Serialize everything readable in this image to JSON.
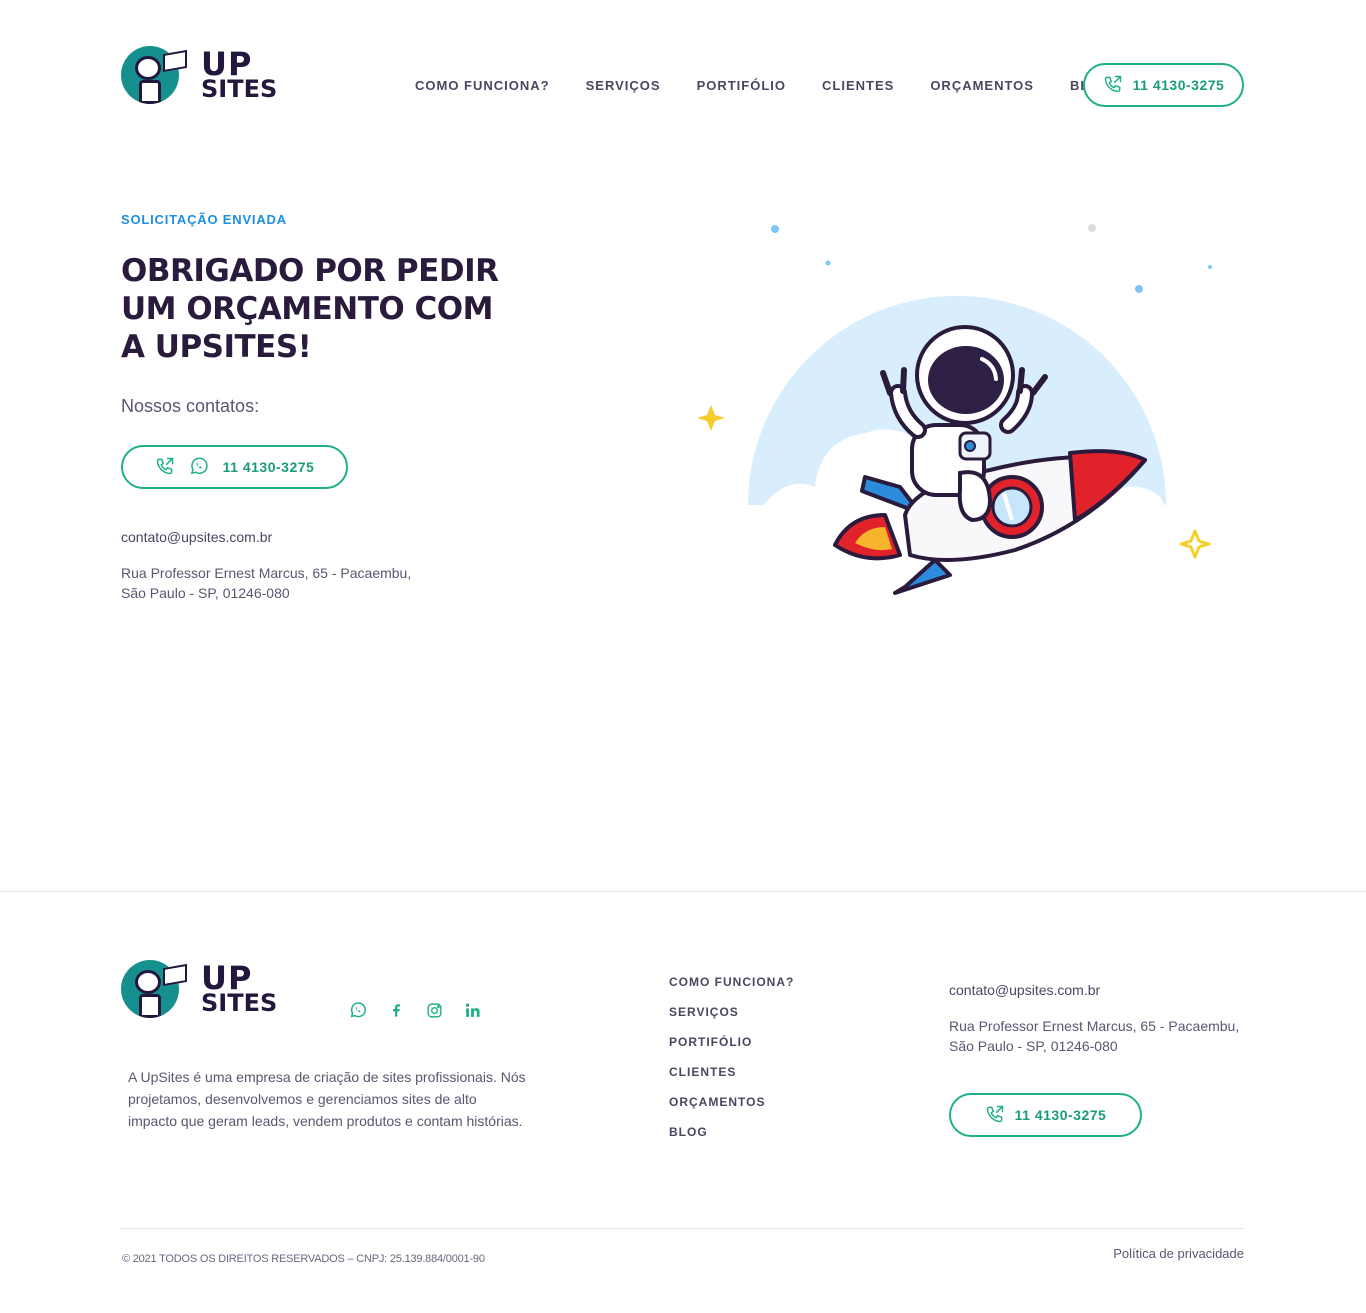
{
  "brand": {
    "name_top": "UP",
    "name_bottom": "SITES",
    "primary_color": "#15908f",
    "dark_color": "#24173d",
    "accent_green": "#1fb08a",
    "accent_blue": "#1e8fe0"
  },
  "header": {
    "nav": [
      {
        "label": "COMO FUNCIONA?"
      },
      {
        "label": "SERVIÇOS"
      },
      {
        "label": "PORTIFÓLIO"
      },
      {
        "label": "CLIENTES"
      },
      {
        "label": "ORÇAMENTOS"
      },
      {
        "label": "BLOG"
      }
    ],
    "phone_label": "11 4130-3275",
    "phone_icon": "phone-outgoing-icon"
  },
  "hero": {
    "eyebrow": "SOLICITAÇÃO ENVIADA",
    "headline": "OBRIGADO POR PEDIR UM ORÇAMENTO COM A UPSITES!",
    "subhead": "Nossos contatos:",
    "phone_label": "11 4130-3275",
    "phone_icons": [
      "phone-outgoing-icon",
      "whatsapp-icon"
    ],
    "email": "contato@upsites.com.br",
    "address_line1": "Rua Professor Ernest Marcus, 65 - Pacaembu,",
    "address_line2": "São Paulo - SP, 01246-080",
    "illustration": "astronaut-on-rocket"
  },
  "footer": {
    "social_icons": [
      "whatsapp-icon",
      "facebook-icon",
      "instagram-icon",
      "linkedin-icon"
    ],
    "about": "A UpSites é uma empresa de criação de sites profissionais. Nós projetamos, desenvolvemos e gerenciamos sites de alto impacto que geram leads, vendem produtos e contam histórias.",
    "nav": [
      {
        "label": "COMO FUNCIONA?"
      },
      {
        "label": "SERVIÇOS"
      },
      {
        "label": "PORTIFÓLIO"
      },
      {
        "label": "CLIENTES"
      },
      {
        "label": "ORÇAMENTOS"
      },
      {
        "label": "BLOG"
      }
    ],
    "email": "contato@upsites.com.br",
    "address_line1": "Rua Professor Ernest Marcus, 65 - Pacaembu,",
    "address_line2": "São Paulo - SP, 01246-080",
    "phone_label": "11 4130-3275",
    "copyright": "© 2021 TODOS OS DIREITOS RESERVADOS – CNPJ: 25.139.884/0001-90",
    "privacy": "Política de privacidade"
  }
}
